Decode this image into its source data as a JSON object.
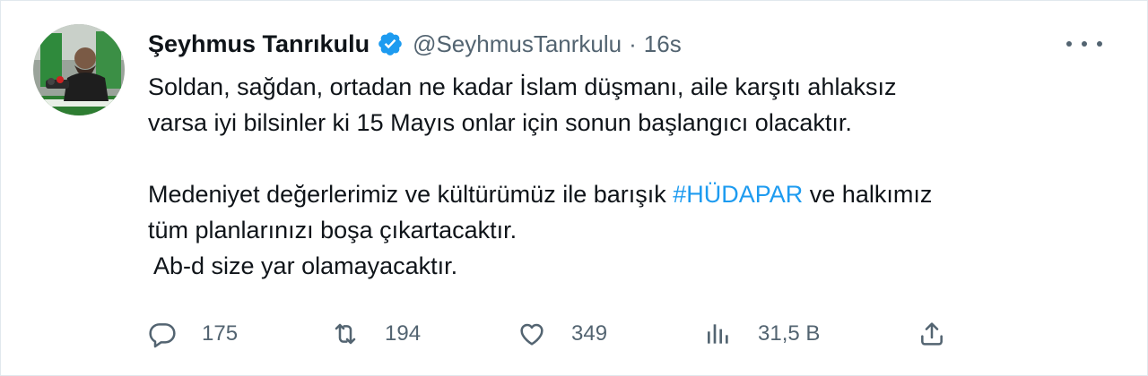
{
  "tweet": {
    "display_name": "Şeyhmus Tanrıkulu",
    "handle": "@SeyhmusTanrkulu",
    "separator": "·",
    "time": "16s",
    "lines": [
      "Soldan, sağdan, ortadan ne kadar İslam düşmanı, aile karşıtı ahlaksız",
      "varsa iyi bilsinler ki 15 Mayıs onlar için sonun başlangıcı olacaktır."
    ],
    "line3_before": "Medeniyet değerlerimiz ve kültürümüz ile barışık ",
    "hashtag": "#HÜDAPAR",
    "line3_after": " ve halkımız",
    "line4": "tüm planlarınızı boşa çıkartacaktır.",
    "line5": " Ab-d size yar olamayacaktır."
  },
  "actions": {
    "replies": "175",
    "retweets": "194",
    "likes": "349",
    "views": "31,5 B"
  },
  "colors": {
    "text": "#0f1419",
    "secondary": "#536471",
    "accent": "#1d9bf0",
    "border": "#e1e8ed"
  },
  "icons": [
    "verified-badge-icon",
    "more-icon",
    "reply-icon",
    "retweet-icon",
    "like-icon",
    "views-icon",
    "share-icon"
  ]
}
